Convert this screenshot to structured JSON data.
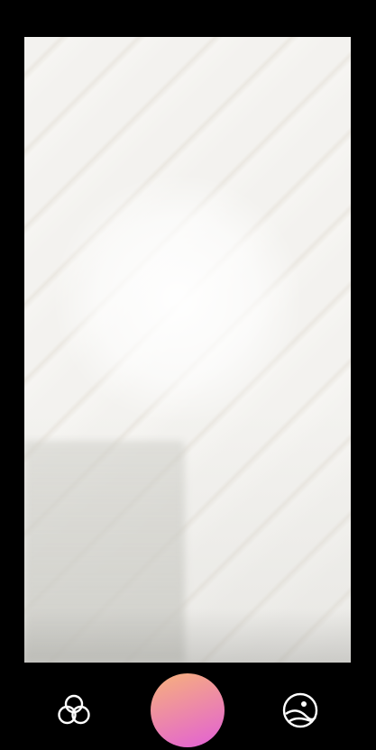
{
  "camera": {
    "viewfinder": {
      "label": ""
    },
    "shutter_button": {
      "gradient_start": "#f7b27a",
      "gradient_end": "#e25fd6"
    },
    "filters_button": {
      "icon": "filters-icon",
      "color": "#ffffff"
    },
    "gallery_button": {
      "icon": "gallery-icon",
      "color": "#ffffff"
    }
  }
}
